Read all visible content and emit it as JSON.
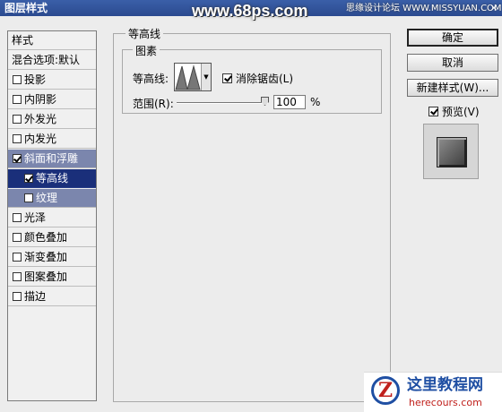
{
  "window": {
    "title": "图层样式",
    "close": "×"
  },
  "watermark": {
    "main": "www.68ps.com",
    "right": "思缘设计论坛 WWW.MISSYUAN.COM"
  },
  "sidebar": {
    "header": "样式",
    "blend": "混合选项:默认",
    "items": [
      {
        "label": "投影",
        "checked": false
      },
      {
        "label": "内阴影",
        "checked": false
      },
      {
        "label": "外发光",
        "checked": false
      },
      {
        "label": "内发光",
        "checked": false
      },
      {
        "label": "斜面和浮雕",
        "checked": true
      },
      {
        "label": "等高线",
        "checked": true
      },
      {
        "label": "纹理",
        "checked": false
      },
      {
        "label": "光泽",
        "checked": false
      },
      {
        "label": "颜色叠加",
        "checked": false
      },
      {
        "label": "渐变叠加",
        "checked": false
      },
      {
        "label": "图案叠加",
        "checked": false
      },
      {
        "label": "描边",
        "checked": false
      }
    ]
  },
  "panel": {
    "group_title": "等高线",
    "sub_title": "图素",
    "contour_label": "等高线:",
    "antialias_label": "消除锯齿(L)",
    "range_label": "范围(R):",
    "range_value": "100",
    "range_unit": "%"
  },
  "buttons": {
    "ok": "确定",
    "cancel": "取消",
    "new_style": "新建样式(W)...",
    "preview": "预览(V)"
  },
  "logo": {
    "line1": "这里教程网",
    "line2": "herecours.com",
    "glyph": "Z"
  }
}
